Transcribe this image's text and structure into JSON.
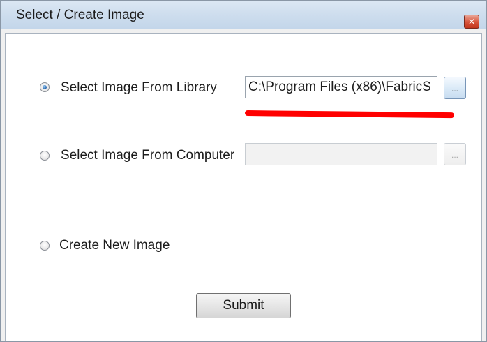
{
  "window": {
    "title": "Select / Create Image",
    "close_glyph": "✕"
  },
  "options": {
    "library": {
      "label": "Select Image From Library",
      "selected": true,
      "path_value": "C:\\Program Files (x86)\\FabricS",
      "browse_label": "..."
    },
    "computer": {
      "label": "Select Image From Computer",
      "selected": false,
      "path_value": "",
      "browse_label": "..."
    },
    "create": {
      "label": "Create New Image",
      "selected": false
    }
  },
  "submit_label": "Submit",
  "colors": {
    "annotation_underline": "#ff0000",
    "title_bar": "#cfdeee",
    "radio_selected": "#1f5ea8"
  }
}
